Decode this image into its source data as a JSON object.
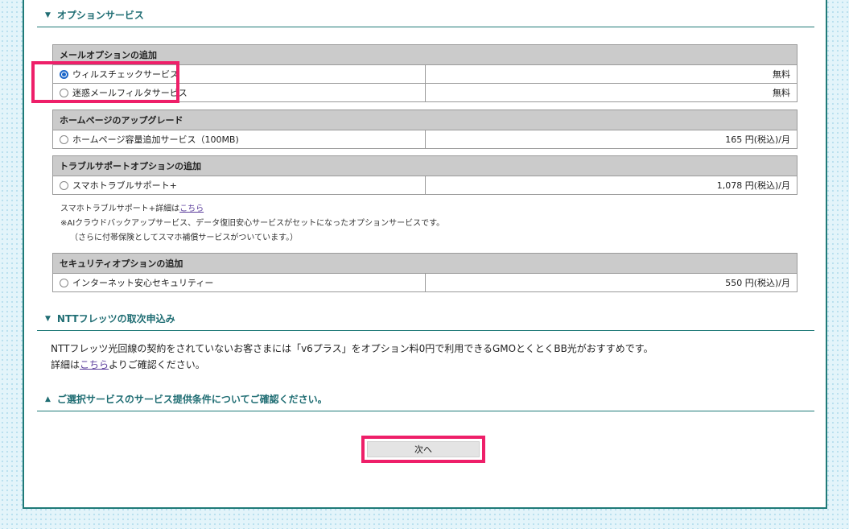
{
  "sections": {
    "options_title": "オプションサービス",
    "ntt_title": "NTTフレッツの取次申込み",
    "terms_title": "ご選択サービスのサービス提供条件についてご確認ください。"
  },
  "mail": {
    "header": "メールオプションの追加",
    "rows": [
      {
        "label": "ウィルスチェックサービス",
        "price": "無料",
        "checked": true
      },
      {
        "label": "迷惑メールフィルタサービス",
        "price": "無料",
        "checked": false
      }
    ]
  },
  "homepage": {
    "header": "ホームページのアップグレード",
    "rows": [
      {
        "label": "ホームページ容量追加サービス（100MB)",
        "price": "165 円(税込)/月",
        "checked": false
      }
    ]
  },
  "support": {
    "header": "トラブルサポートオプションの追加",
    "rows": [
      {
        "label": "スマホトラブルサポート+",
        "price": "1,078 円(税込)/月",
        "checked": false
      }
    ],
    "note_prefix": "スマホトラブルサポート+詳細は",
    "note_link": "こちら",
    "note_line2": "※AIクラウドバックアップサービス、データ復旧安心サービスがセットになったオプションサービスです。",
    "note_line3": "（さらに付帯保険としてスマホ補償サービスがついています。）"
  },
  "security": {
    "header": "セキュリティオプションの追加",
    "rows": [
      {
        "label": "インターネット安心セキュリティー",
        "price": "550 円(税込)/月",
        "checked": false
      }
    ]
  },
  "ntt": {
    "line1": "NTTフレッツ光回線の契約をされていないお客さまには「v6プラス」をオプション料0円で利用できるGMOとくとくBB光がおすすめです。",
    "line2_prefix": "詳細は",
    "line2_link": "こちら",
    "line2_suffix": "よりご確認ください。"
  },
  "next_button": "次へ"
}
